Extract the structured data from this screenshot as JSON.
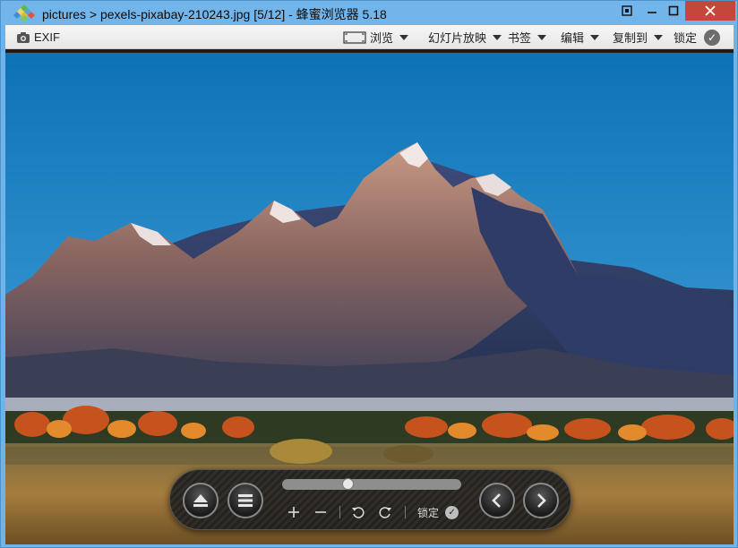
{
  "window": {
    "title": "pictures > pexels-pixabay-210243.jpg [5/12] - 蜂蜜浏览器 5.18",
    "icons": [
      "app-diamond-icon",
      "fullscreen-icon",
      "minimize-icon",
      "maximize-icon",
      "close-icon"
    ]
  },
  "toolbar": {
    "exif_label": "EXIF",
    "browse_label": "浏览",
    "slideshow_label": "幻灯片放映",
    "bookmark_label": "书签",
    "edit_label": "编辑",
    "copyto_label": "复制到",
    "lock_label": "锁定"
  },
  "viewer": {
    "image_subject": "mountain-landscape",
    "progress_fraction": 0.36
  },
  "controls": {
    "lock_label": "锁定",
    "icons": [
      "eject-icon",
      "menu-icon",
      "zoom-in-icon",
      "zoom-out-icon",
      "rotate-left-icon",
      "rotate-right-icon",
      "prev-icon",
      "next-icon"
    ]
  },
  "colors": {
    "titlebar": "#71b5ea",
    "close": "#c7463c",
    "toolbar": "#ececec"
  }
}
